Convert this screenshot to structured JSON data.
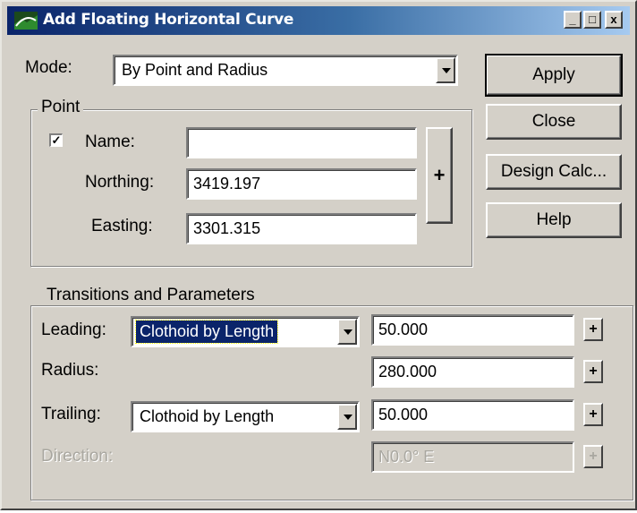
{
  "window": {
    "title": "Add Floating Horizontal Curve",
    "minimize_glyph": "_",
    "maximize_glyph": "□",
    "close_glyph": "x"
  },
  "mode": {
    "label": "Mode:",
    "value": "By Point and Radius"
  },
  "point": {
    "caption": "Point",
    "name_checked": true,
    "check_glyph": "✓",
    "name_label": "Name:",
    "name_value": "",
    "northing_label": "Northing:",
    "northing_value": "3419.197",
    "easting_label": "Easting:",
    "easting_value": "3301.315",
    "pick_glyph": "+"
  },
  "buttons": {
    "apply": "Apply",
    "close": "Close",
    "design_calc": "Design Calc...",
    "help": "Help"
  },
  "transitions": {
    "caption": "Transitions and Parameters",
    "leading_label": "Leading:",
    "leading_type": "Clothoid by Length",
    "leading_value": "50.000",
    "radius_label": "Radius:",
    "radius_value": "280.000",
    "trailing_label": "Trailing:",
    "trailing_type": "Clothoid by Length",
    "trailing_value": "50.000",
    "direction_label": "Direction:",
    "direction_value": "N0.0° E",
    "pick_glyph": "+"
  },
  "colors": {
    "dialog_bg": "#d4d0c8",
    "title_active_start": "#0a246a",
    "title_active_end": "#a6caf0",
    "selection": "#0a246a"
  },
  "icons": [
    "app-icon",
    "minimize-icon",
    "maximize-icon",
    "close-icon",
    "checkbox-check-icon",
    "pick-point-icon"
  ]
}
